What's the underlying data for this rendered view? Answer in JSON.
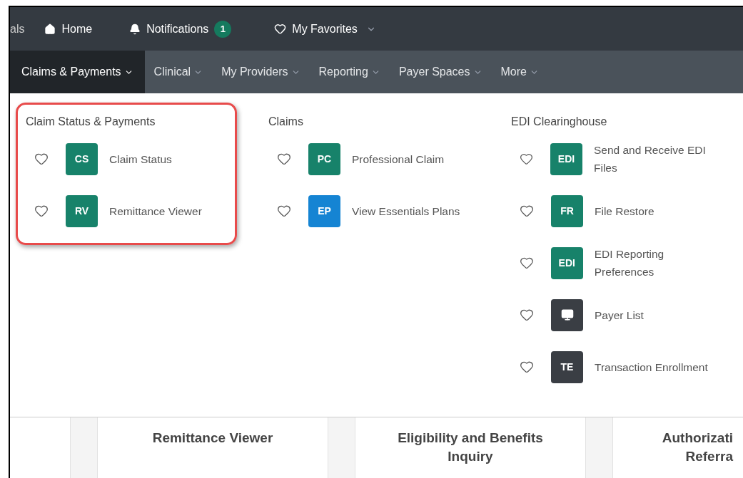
{
  "top_bar": {
    "cut_label": "als",
    "links": [
      {
        "kind": "home",
        "label": "Home"
      },
      {
        "kind": "notifications",
        "label": "Notifications",
        "badge": "1"
      },
      {
        "kind": "favorites",
        "label": "My Favorites"
      }
    ]
  },
  "nav": [
    {
      "label": "Claims & Payments",
      "selected": true
    },
    {
      "label": "Clinical",
      "selected": false
    },
    {
      "label": "My Providers",
      "selected": false
    },
    {
      "label": "Reporting",
      "selected": false
    },
    {
      "label": "Payer Spaces",
      "selected": false
    },
    {
      "label": "More",
      "selected": false
    }
  ],
  "menu_columns": [
    {
      "title": "Claim Status & Payments",
      "highlighted": true,
      "items": [
        {
          "kind": "text",
          "badge": "CS",
          "color": "#17826a",
          "label": "Claim Status"
        },
        {
          "kind": "text",
          "badge": "RV",
          "color": "#17826a",
          "label": "Remittance Viewer"
        }
      ]
    },
    {
      "title": "Claims",
      "highlighted": false,
      "items": [
        {
          "kind": "text",
          "badge": "PC",
          "color": "#17826a",
          "label": "Professional Claim"
        },
        {
          "kind": "text",
          "badge": "EP",
          "color": "#1584d3",
          "label": "View Essentials Plans"
        }
      ]
    },
    {
      "title": "EDI Clearinghouse",
      "highlighted": false,
      "items": [
        {
          "kind": "text",
          "badge": "EDI",
          "color": "#17826a",
          "label": "Send and Receive EDI Files"
        },
        {
          "kind": "text",
          "badge": "FR",
          "color": "#17826a",
          "label": "File Restore"
        },
        {
          "kind": "text",
          "badge": "EDI",
          "color": "#17826a",
          "label": "EDI Reporting Preferences"
        },
        {
          "kind": "monitor",
          "color": "#3a3e44",
          "label": "Payer List"
        },
        {
          "kind": "text",
          "badge": "TE",
          "color": "#3a3e44",
          "label": "Transaction Enrollment"
        }
      ]
    }
  ],
  "cards": [
    "Remittance Viewer",
    "Eligibility and Benefits Inquiry",
    "Authorizati\nReferra"
  ]
}
